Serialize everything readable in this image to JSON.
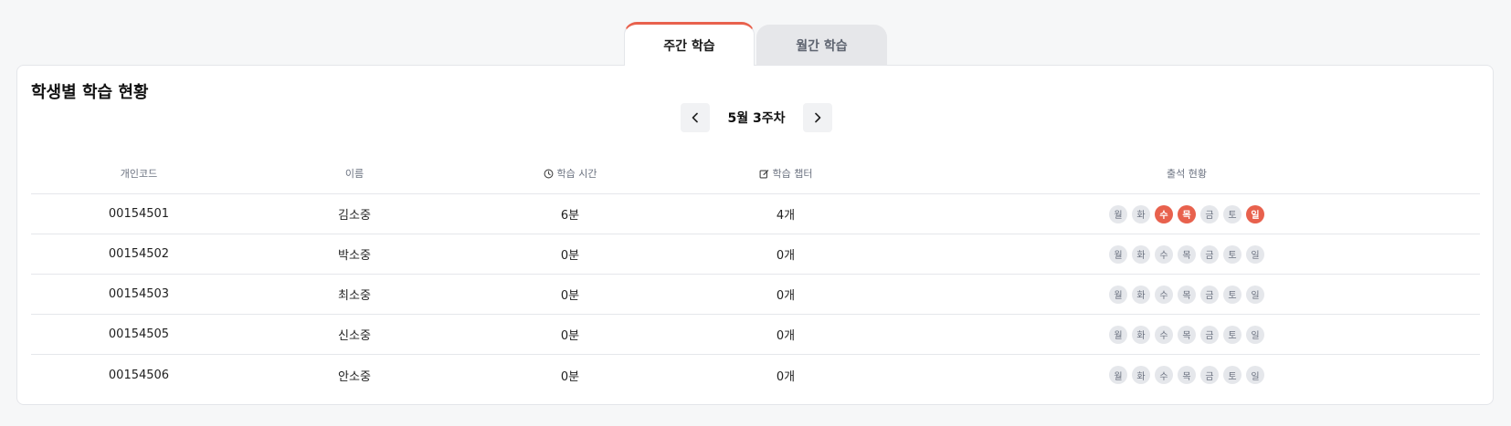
{
  "tabs": [
    {
      "label": "주간 학습",
      "active": true
    },
    {
      "label": "월간 학습",
      "active": false
    }
  ],
  "card": {
    "title": "학생별 학습 현황"
  },
  "week_nav": {
    "label": "5월 3주차",
    "prev_icon": "chevron-left-icon",
    "next_icon": "chevron-right-icon"
  },
  "table": {
    "headers": {
      "code": "개인코드",
      "name": "이름",
      "time": "학습 시간",
      "chapter": "학습 챕터",
      "attendance": "출석 현황"
    },
    "day_labels": [
      "월",
      "화",
      "수",
      "목",
      "금",
      "토",
      "일"
    ],
    "rows": [
      {
        "code": "00154501",
        "name": "김소중",
        "time": "6분",
        "chapter": "4개",
        "attendance": [
          false,
          false,
          true,
          true,
          false,
          false,
          true
        ]
      },
      {
        "code": "00154502",
        "name": "박소중",
        "time": "0분",
        "chapter": "0개",
        "attendance": [
          false,
          false,
          false,
          false,
          false,
          false,
          false
        ]
      },
      {
        "code": "00154503",
        "name": "최소중",
        "time": "0분",
        "chapter": "0개",
        "attendance": [
          false,
          false,
          false,
          false,
          false,
          false,
          false
        ]
      },
      {
        "code": "00154505",
        "name": "신소중",
        "time": "0분",
        "chapter": "0개",
        "attendance": [
          false,
          false,
          false,
          false,
          false,
          false,
          false
        ]
      },
      {
        "code": "00154506",
        "name": "안소중",
        "time": "0분",
        "chapter": "0개",
        "attendance": [
          false,
          false,
          false,
          false,
          false,
          false,
          false
        ]
      }
    ]
  },
  "colors": {
    "accent": "#e8614d",
    "inactive_day": "#e5e7eb"
  }
}
